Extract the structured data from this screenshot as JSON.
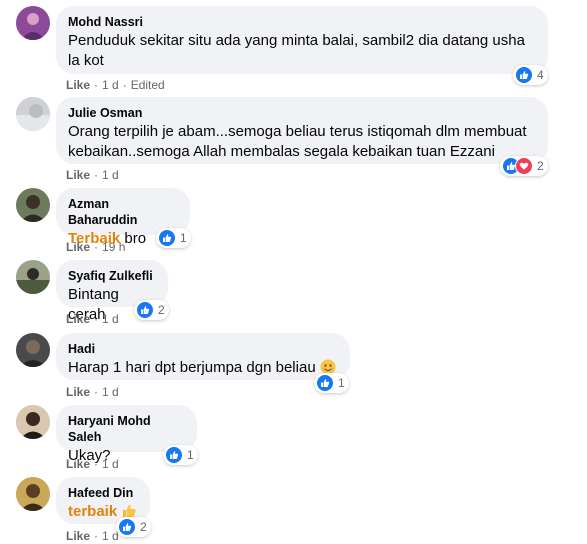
{
  "comments": [
    {
      "author": "Mohd Nassri",
      "text": "Penduduk sekitar situ ada yang minta balai, sambil2 dia datang usha la kot",
      "like_label": "Like",
      "time": "1 d",
      "edited": "Edited",
      "reaction_count": "4",
      "reactions": [
        "like"
      ]
    },
    {
      "author": "Julie Osman",
      "text": "Orang terpilih je abam...semoga beliau terus istiqomah dlm membuat kebaikan..semoga Allah membalas segala kebaikan tuan Ezzani",
      "like_label": "Like",
      "time": "1 d",
      "reaction_count": "2",
      "reactions": [
        "like",
        "love"
      ]
    },
    {
      "author": "Azman Baharuddin",
      "text_highlight": "Terbaik",
      "text": " bro",
      "like_label": "Like",
      "time": "19 h",
      "reaction_count": "1",
      "reactions": [
        "like"
      ]
    },
    {
      "author": "Syafiq Zulkefli",
      "text": "Bintang cerah",
      "like_label": "Like",
      "time": "1 d",
      "reaction_count": "2",
      "reactions": [
        "like"
      ]
    },
    {
      "author": "Hadi",
      "text": "Harap 1 hari dpt berjumpa dgn beliau",
      "emoji": "smiling-face-emoji",
      "like_label": "Like",
      "time": "1 d",
      "reaction_count": "1",
      "reactions": [
        "like"
      ]
    },
    {
      "author": "Haryani Mohd Saleh",
      "text": "Ukay?",
      "like_label": "Like",
      "time": "1 d",
      "reaction_count": "1",
      "reactions": [
        "like"
      ]
    },
    {
      "author": "Hafeed Din",
      "text_highlight": "terbaik",
      "emoji": "thumbs-up-emoji",
      "like_label": "Like",
      "time": "1 d",
      "reaction_count": "2",
      "reactions": [
        "like"
      ]
    }
  ],
  "colors": {
    "bubble_bg": "#f0f2f5",
    "meta_text": "#65676b",
    "like_blue": "#1877f2",
    "love_red": "#f33e58",
    "highlight": "#e4830b"
  },
  "separator": "·"
}
